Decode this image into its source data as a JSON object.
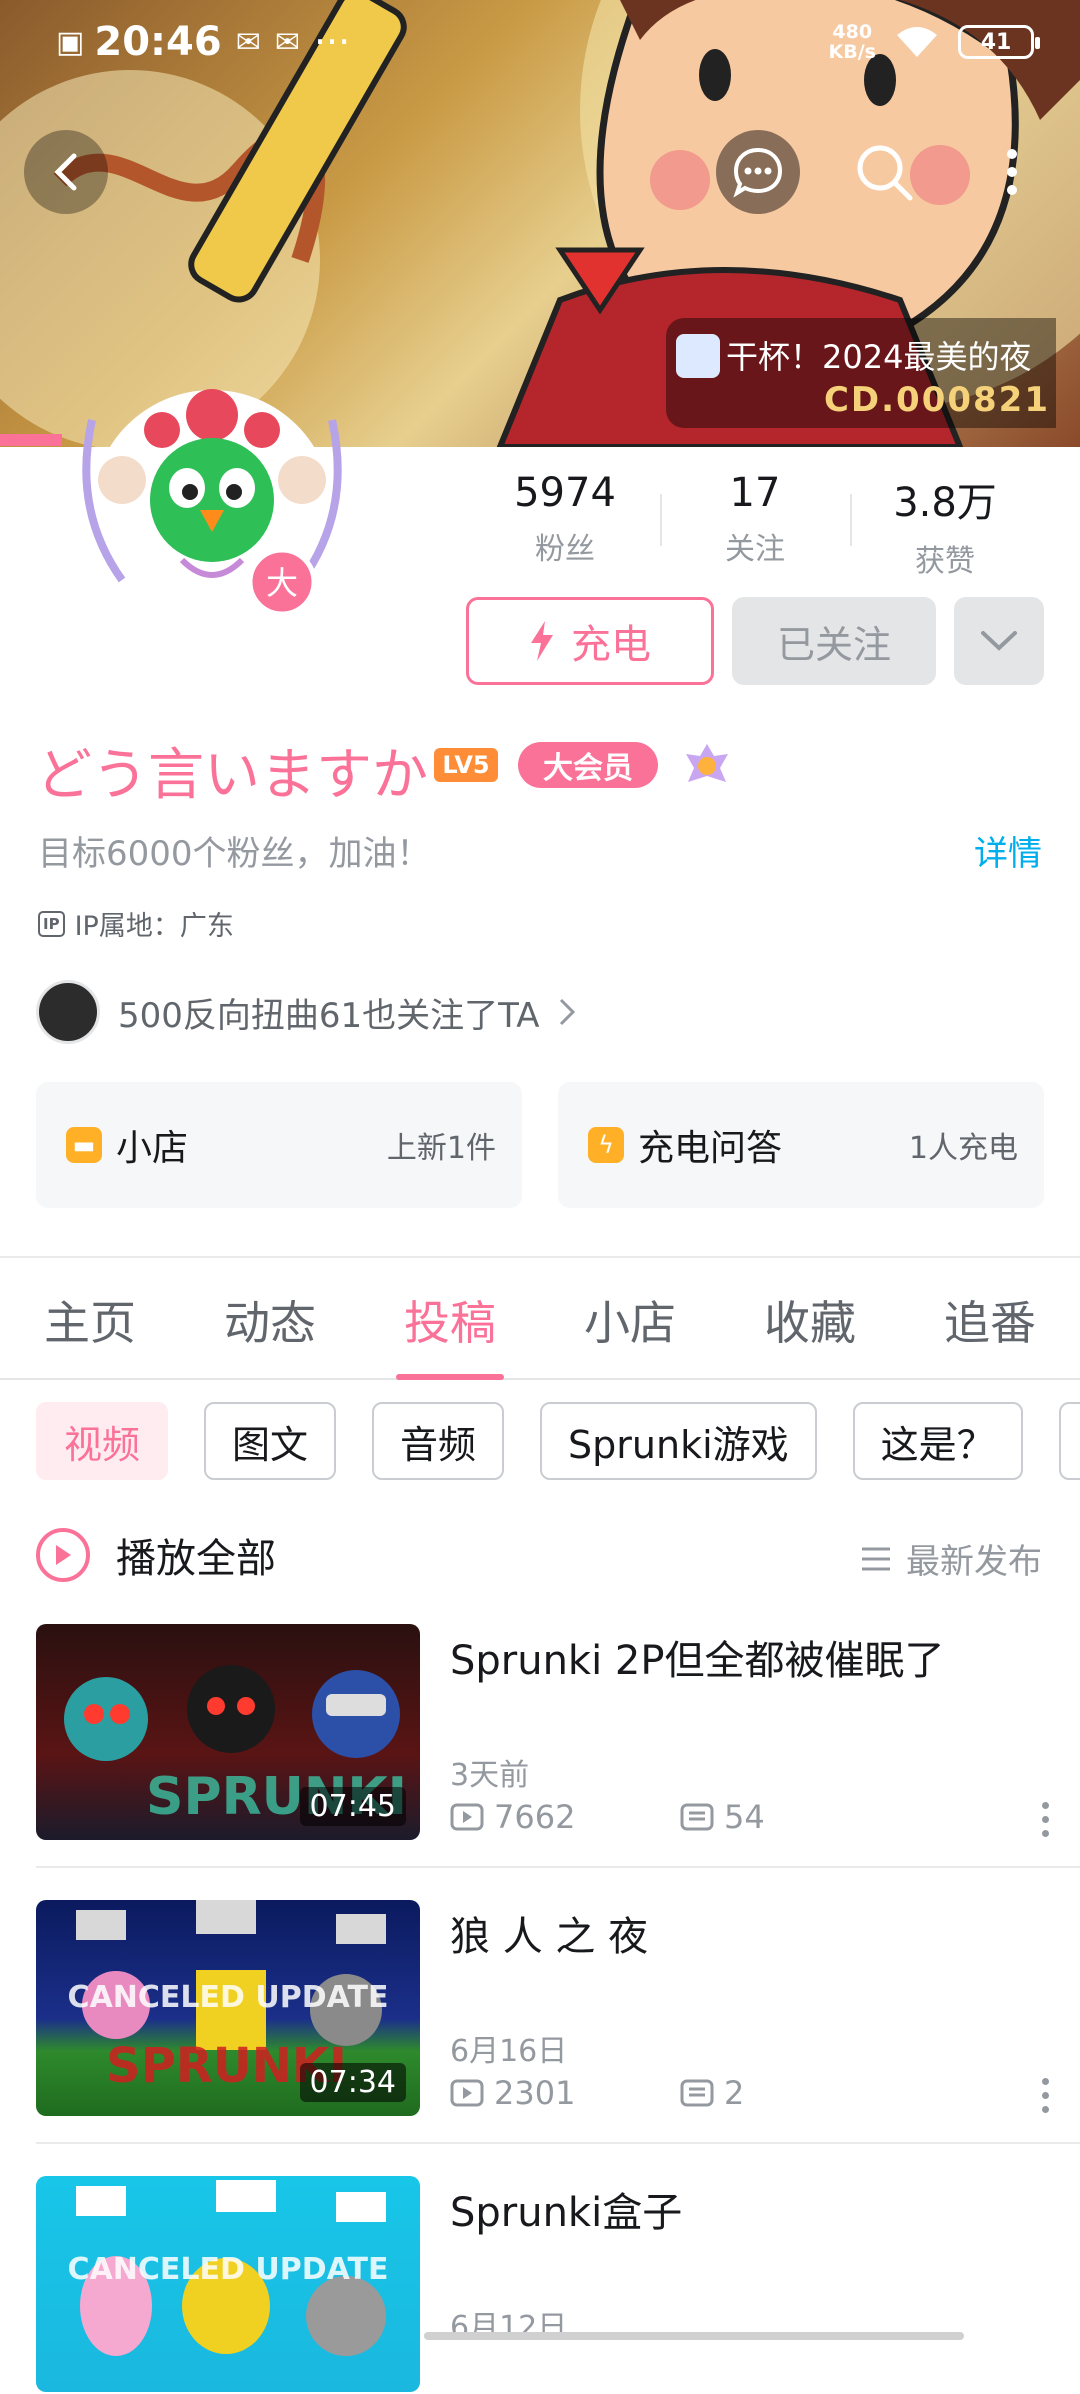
{
  "status_bar": {
    "time": "20:46",
    "speed_value": "480",
    "speed_unit": "KB/s",
    "battery": "41"
  },
  "banner": {
    "event_text": "干杯！2024最美的夜",
    "serial": "CD.000821"
  },
  "stats": [
    {
      "value": "5974",
      "label": "粉丝"
    },
    {
      "value": "17",
      "label": "关注"
    },
    {
      "value": "3.8万",
      "label": "获赞"
    }
  ],
  "actions": {
    "charge": "充电",
    "followed": "已关注"
  },
  "avatar_badge": "大",
  "profile": {
    "username": "どう言いますか",
    "level": "LV5",
    "vip": "大会员",
    "signature": "目标6000个粉丝，加油！",
    "detail_link": "详情",
    "ip_icon": "IP",
    "ip": "IP属地：广东",
    "mutual": "500反向扭曲61也关注了TA"
  },
  "cards": [
    {
      "title": "小店",
      "meta": "上新1件",
      "icon": "shop-icon"
    },
    {
      "title": "充电问答",
      "meta": "1人充电",
      "icon": "lightning-icon"
    }
  ],
  "tabs": [
    "主页",
    "动态",
    "投稿",
    "小店",
    "收藏",
    "追番"
  ],
  "active_tab": 2,
  "chips": [
    "视频",
    "图文",
    "音频",
    "Sprunki游戏",
    "这是？"
  ],
  "play_all": "播放全部",
  "sort_label": "最新发布",
  "videos": [
    {
      "title": "Sprunki 2P但全都被催眠了",
      "duration": "07:45",
      "date": "3天前",
      "views": "7662",
      "comments": "54",
      "thumb_text": "SPRUNKI"
    },
    {
      "title": "狼 人 之 夜",
      "duration": "07:34",
      "date": "6月16日",
      "views": "2301",
      "comments": "2",
      "thumb_text": "CANCELED UPDATE"
    },
    {
      "title": "Sprunki盒子",
      "duration": "",
      "date": "6月12日",
      "views": "",
      "comments": "",
      "thumb_text": "CANCELED UPDATE"
    }
  ],
  "colors": {
    "accent": "#fb7299",
    "link": "#00aeec",
    "muted": "#9499a0"
  }
}
